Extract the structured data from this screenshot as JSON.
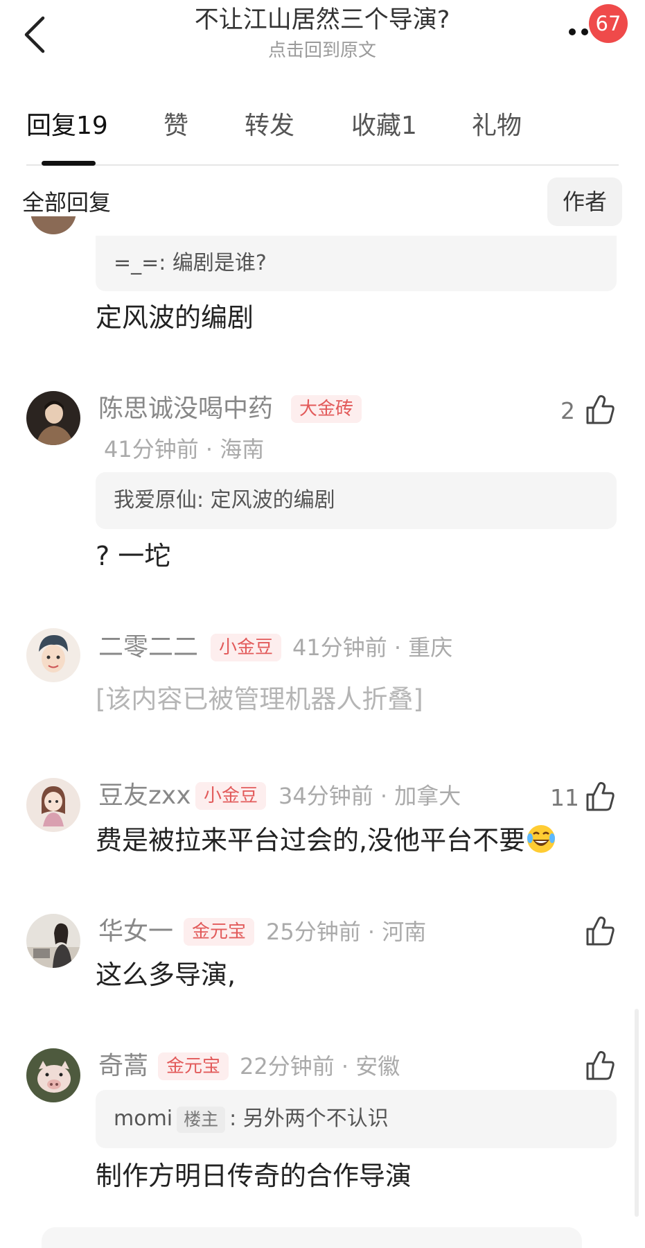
{
  "header": {
    "title": "不让江山居然三个导演?",
    "subtitle": "点击回到原文",
    "badge": "67"
  },
  "tabs": [
    {
      "label": "回复",
      "count": "19"
    },
    {
      "label": "赞",
      "count": ""
    },
    {
      "label": "转发",
      "count": ""
    },
    {
      "label": "收藏",
      "count": "1"
    },
    {
      "label": "礼物",
      "count": ""
    }
  ],
  "section": {
    "title": "全部回复",
    "author_button": "作者"
  },
  "comments": [
    {
      "quote": "=_=: 编剧是谁?",
      "text": "定风波的编剧"
    },
    {
      "name": "陈思诚没喝中药",
      "tag": "大金砖",
      "meta": "41分钟前 · 海南",
      "likes": "2",
      "quote": "我爱原仙: 定风波的编剧",
      "text": "? 一坨"
    },
    {
      "name": "二零二二",
      "tag": "小金豆",
      "meta": "41分钟前 · 重庆",
      "folded": "[该内容已被管理机器人折叠]"
    },
    {
      "name": "豆友zxx",
      "tag": "小金豆",
      "meta": "34分钟前 · 加拿大",
      "likes": "11",
      "text": "费是被拉来平台过会的,没他平台不要"
    },
    {
      "name": "华女一",
      "tag": "金元宝",
      "meta": "25分钟前 · 河南",
      "text": "这么多导演,"
    },
    {
      "name": "奇蒿",
      "tag": "金元宝",
      "meta": "22分钟前 · 安徽",
      "quote_user": "momi",
      "quote_owner_tag": "楼主",
      "quote_text": ": 另外两个不认识",
      "text": "制作方明日传奇的合作导演"
    }
  ],
  "colors": {
    "badge": "#ef4a4a",
    "tag_bg": "#fdeeee",
    "tag_text": "#e25a5a",
    "quote_bg": "#f5f5f5"
  },
  "icons": [
    "back-arrow-icon",
    "more-dots-icon",
    "thumbs-up-icon",
    "laugh-cry-emoji-icon"
  ]
}
